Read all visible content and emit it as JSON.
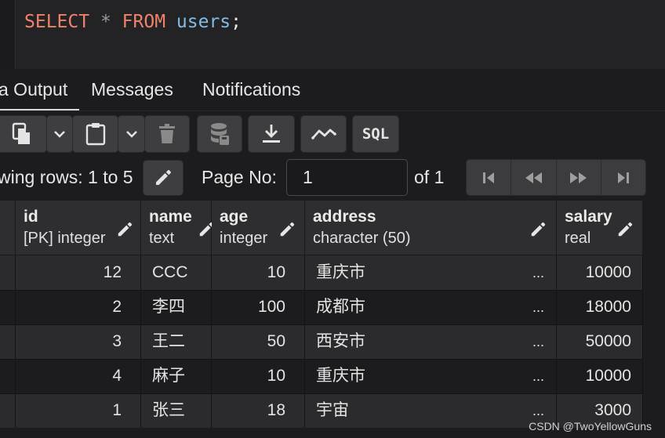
{
  "editor": {
    "kw_select": "SELECT",
    "star": "*",
    "kw_from": "FROM",
    "table": "users",
    "semicolon": ";"
  },
  "tabs": [
    {
      "label": "a Output",
      "active": true
    },
    {
      "label": "Messages",
      "active": false
    },
    {
      "label": "Notifications",
      "active": false
    }
  ],
  "toolbar": {
    "icons": [
      "copy-icon",
      "chevron-down-icon",
      "paste-icon",
      "chevron-down-icon",
      "delete-icon",
      "save-data-icon",
      "download-icon",
      "graph-icon"
    ],
    "sql_label": "SQL"
  },
  "pager": {
    "showing_rows": "wing rows: 1 to 5",
    "page_no_label": "Page No:",
    "page_value": "1",
    "of_label": "of 1",
    "nav_icons": [
      "first-page-icon",
      "previous-page-icon",
      "next-page-icon",
      "last-page-icon"
    ]
  },
  "columns": [
    {
      "name": "id",
      "type": "[PK] integer"
    },
    {
      "name": "name",
      "type": "text"
    },
    {
      "name": "age",
      "type": "integer"
    },
    {
      "name": "address",
      "type": "character (50)"
    },
    {
      "name": "salary",
      "type": "real"
    }
  ],
  "rows": [
    {
      "id": "12",
      "name": "CCC",
      "age": "10",
      "address": "重庆市",
      "salary": "10000"
    },
    {
      "id": "2",
      "name": "李四",
      "age": "100",
      "address": "成都市",
      "salary": "18000"
    },
    {
      "id": "3",
      "name": "王二",
      "age": "50",
      "address": "西安市",
      "salary": "50000"
    },
    {
      "id": "4",
      "name": "麻子",
      "age": "10",
      "address": "重庆市",
      "salary": "10000"
    },
    {
      "id": "1",
      "name": "张三",
      "age": "18",
      "address": "宇宙",
      "salary": "3000"
    }
  ],
  "ellipsis": "...",
  "watermark": "CSDN @TwoYellowGuns",
  "colors": {
    "keyword": "#f0826a",
    "identifier": "#84bce8",
    "background": "#1c1c1e",
    "button": "#3e3e40"
  }
}
